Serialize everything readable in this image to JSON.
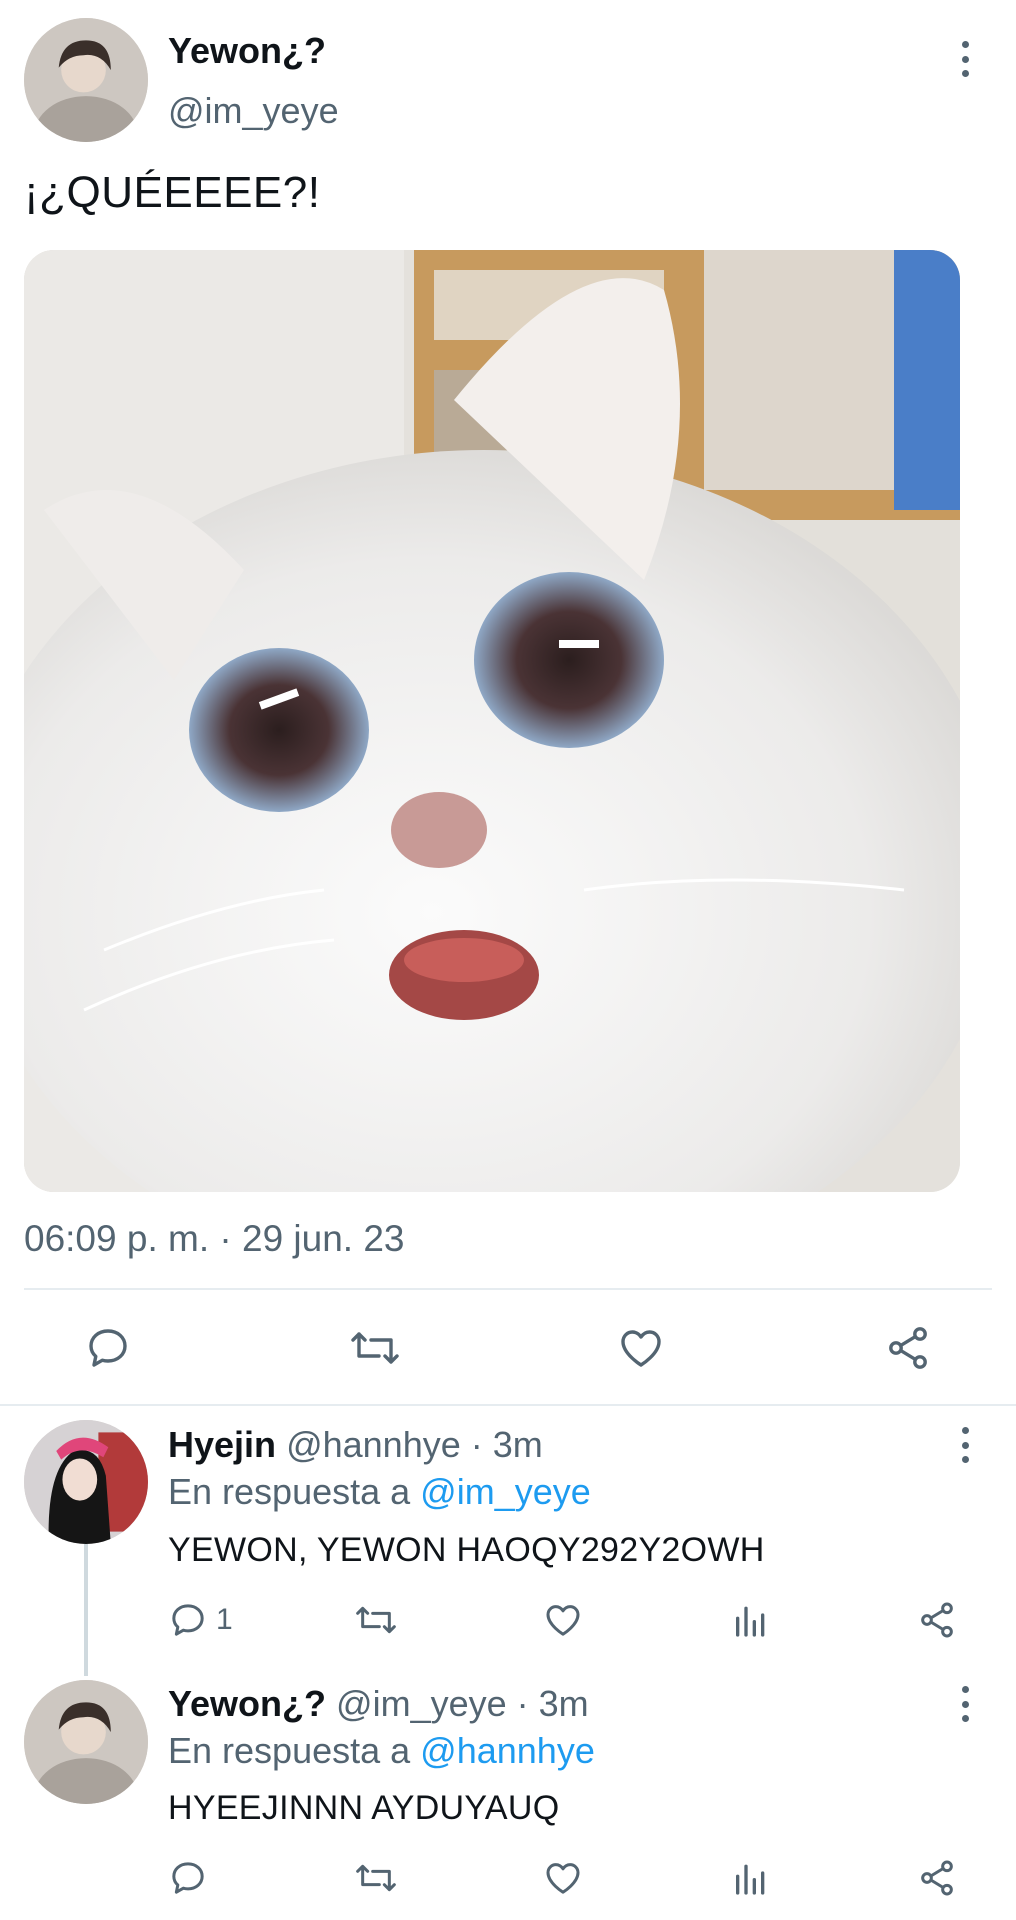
{
  "main_tweet": {
    "display_name": "Yewon¿?",
    "handle": "@im_yeye",
    "text": "¡¿QUÉEEEE?!",
    "timestamp": "06:09 p. m. · 29 jun. 23",
    "media_alt": "white cat with open mouth",
    "actions": [
      "reply-icon",
      "retweet-icon",
      "like-icon",
      "share-icon"
    ]
  },
  "replies": [
    {
      "display_name": "Hyejin",
      "meta": "@hannhye · 3m",
      "reply_prefix": "En respuesta a",
      "reply_to": "@im_yeye",
      "text": "YEWON, YEWON HAOQY292Y2OWH",
      "reply_count": "1"
    },
    {
      "display_name": "Yewon¿?",
      "meta": "@im_yeye · 3m",
      "reply_prefix": "En respuesta a",
      "reply_to": "@hannhye",
      "text": "HYEEJINNN AYDUYAUQ",
      "reply_count": ""
    }
  ],
  "colors": {
    "text_primary": "#0f1419",
    "text_secondary": "#536471",
    "link": "#1d9bf0",
    "divider": "#e6ecf0"
  }
}
